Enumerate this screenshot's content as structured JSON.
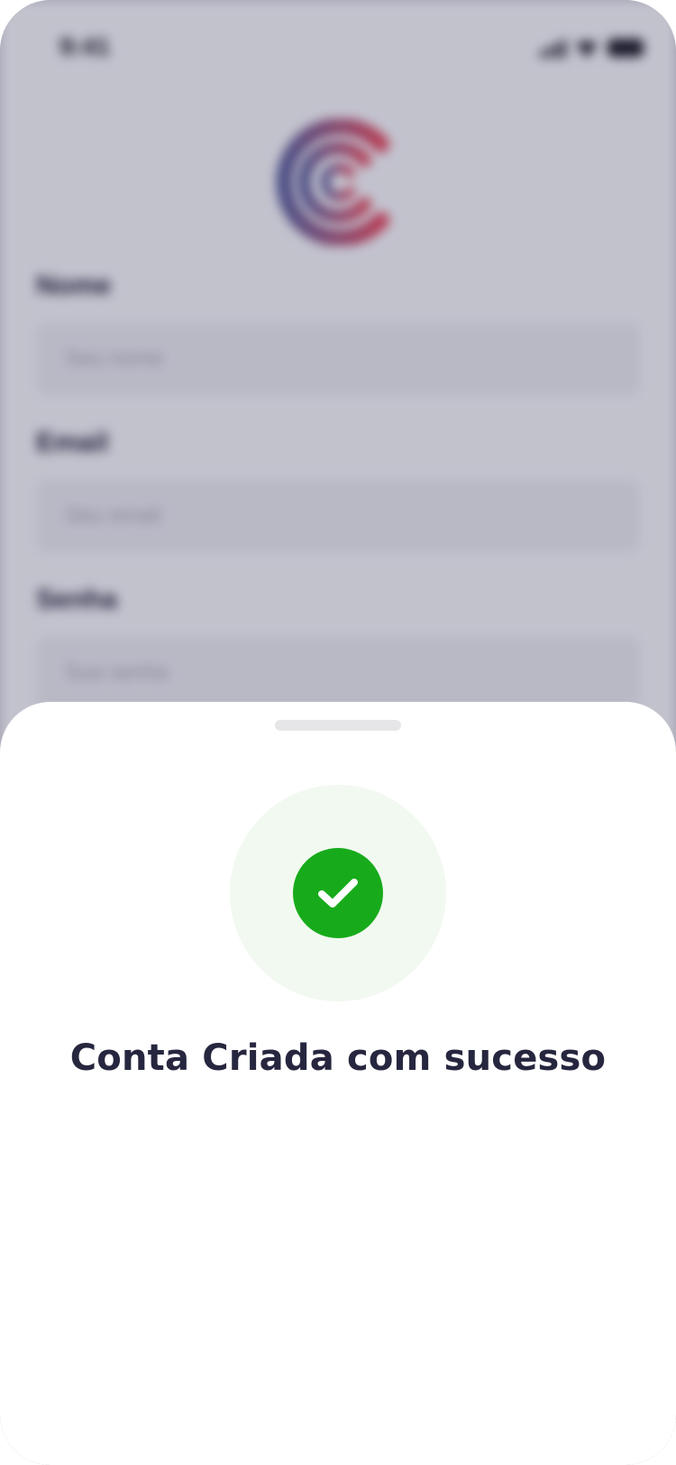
{
  "status_bar": {
    "time": "9:41"
  },
  "form": {
    "name": {
      "label": "Nome",
      "placeholder": "Seu nome"
    },
    "email": {
      "label": "Email",
      "placeholder": "Seu email"
    },
    "password": {
      "label": "Senha",
      "placeholder": "Sua senha"
    }
  },
  "sheet": {
    "title": "Conta Criada com sucesso",
    "icon": "check-circle-icon"
  },
  "colors": {
    "success": "#17ab1b",
    "success_halo": "#f1f9f0",
    "title_text": "#26273f",
    "logo_blue": "#5b5f9a",
    "logo_red": "#e2475b"
  }
}
